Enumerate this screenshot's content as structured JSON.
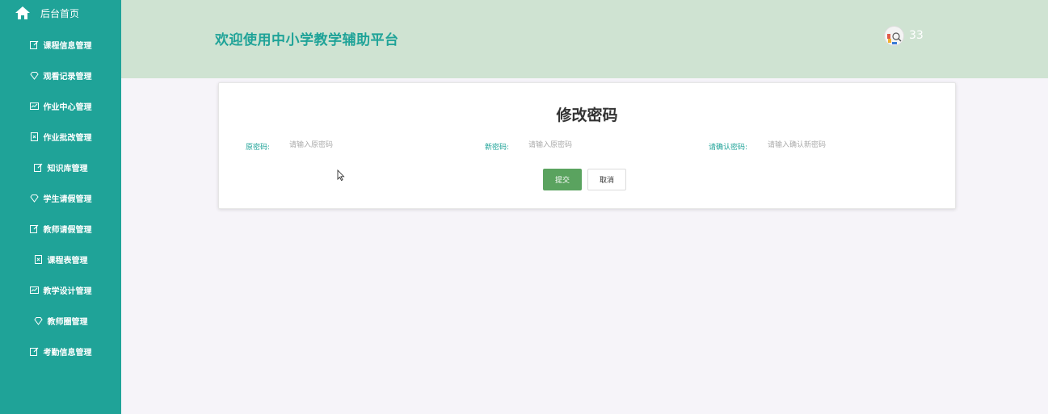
{
  "sidebar": {
    "home_label": "后台首页",
    "items": [
      {
        "label": "课程信息管理",
        "icon": "edit-icon"
      },
      {
        "label": "观看记录管理",
        "icon": "diamond-icon"
      },
      {
        "label": "作业中心管理",
        "icon": "chart-icon"
      },
      {
        "label": "作业批改管理",
        "icon": "doc-icon"
      },
      {
        "label": "知识库管理",
        "icon": "edit-icon"
      },
      {
        "label": "学生请假管理",
        "icon": "diamond-icon"
      },
      {
        "label": "教师请假管理",
        "icon": "edit-icon"
      },
      {
        "label": "课程表管理",
        "icon": "doc-icon"
      },
      {
        "label": "教学设计管理",
        "icon": "chart-icon"
      },
      {
        "label": "教师圈管理",
        "icon": "diamond-icon"
      },
      {
        "label": "考勤信息管理",
        "icon": "edit-icon"
      }
    ]
  },
  "header": {
    "title": "欢迎使用中小学教学辅助平台",
    "username": "33"
  },
  "form": {
    "title": "修改密码",
    "old_password": {
      "label": "原密码:",
      "placeholder": "请输入原密码"
    },
    "new_password": {
      "label": "新密码:",
      "placeholder": "请输入原密码"
    },
    "confirm_password": {
      "label": "请确认密码:",
      "placeholder": "请输入确认新密码"
    },
    "submit_label": "提交",
    "cancel_label": "取消"
  },
  "colors": {
    "sidebar_bg": "#1fa398",
    "header_bg": "#cfe3d2",
    "accent": "#1fa398",
    "submit_bg": "#5aa35f"
  }
}
